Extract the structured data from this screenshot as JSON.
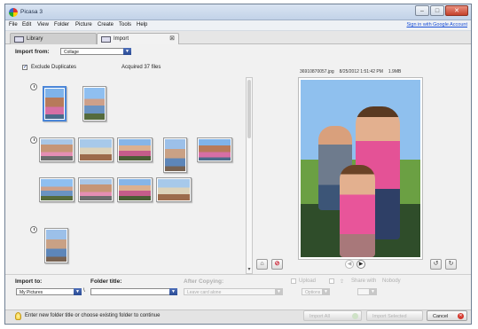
{
  "window": {
    "title": "Picasa 3",
    "controls": [
      "–",
      "□",
      "✕"
    ]
  },
  "menu": {
    "items": [
      "File",
      "Edit",
      "View",
      "Folder",
      "Picture",
      "Create",
      "Tools",
      "Help"
    ],
    "signin": "Sign in with Google Account"
  },
  "tabs": [
    {
      "label": "Library"
    },
    {
      "label": "Import",
      "close": "⊠"
    }
  ],
  "import_from": {
    "label": "Import from:",
    "value": "Collage"
  },
  "options": {
    "exclude_duplicates": "Exclude Duplicates",
    "acquired": "Acquired 37 files"
  },
  "preview_meta": {
    "filename": "36910870057.jpg",
    "datetime": "8/25/2012 1:51:42 PM",
    "size": "1.9MB"
  },
  "bottom": {
    "import_to_label": "Import to:",
    "import_to_value": "My Pictures",
    "folder_title_label": "Folder title:",
    "folder_title_value": "",
    "after_copying_label": "After Copying:",
    "after_copying_value": "Leave card alone",
    "upload_label": "Upload",
    "share_with_label": "Share with",
    "share_with_value": "Nobody",
    "upload_option": "Options"
  },
  "status": {
    "hint": "Enter new folder title or choose existing folder to continue"
  },
  "buttons": {
    "import_all": "Import All",
    "import_selected": "Import Selected",
    "cancel": "Cancel"
  },
  "icons": {
    "clock": "clock-icon",
    "bulb": "lightbulb-icon",
    "rotate_left": "↺",
    "rotate_right": "↻",
    "exclude": "⊘",
    "prev": "◀",
    "next": "▶",
    "check": "✓"
  }
}
